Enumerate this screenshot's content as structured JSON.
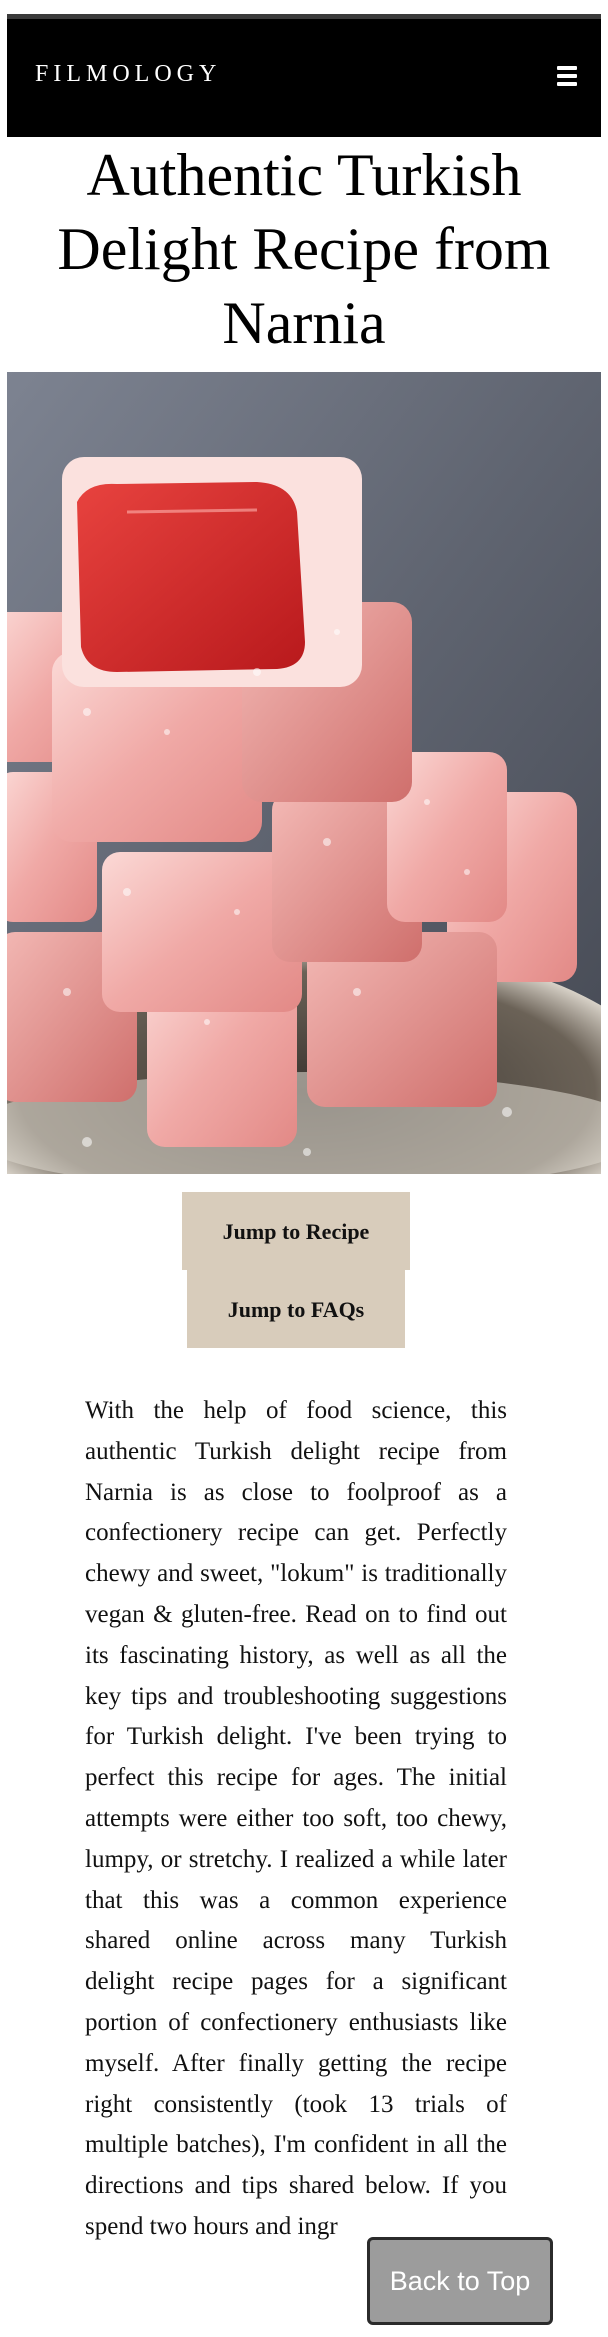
{
  "header": {
    "brand": "FILMOLOGY",
    "menu_icon": "hamburger-menu-icon",
    "background": "#000000"
  },
  "article": {
    "title": "Authentic Turkish Delight Recipe from Narnia",
    "hero_image": "turkish-delight-photo",
    "buttons": {
      "jump_to_recipe": "Jump to Recipe",
      "jump_to_faqs": "Jump to FAQs"
    },
    "button_color": "#d8ccbb",
    "intro": "With the help of food science, this authentic Turkish delight recipe from Narnia is as close to foolproof as a confectionery recipe can get. Perfectly chewy and sweet, \"lokum\" is traditionally vegan & gluten-free. Read on to find out its fascinating history, as well as all the key tips and troubleshooting suggestions for Turkish delight. I've been trying to perfect this recipe for ages. The initial attempts were either too soft, too chewy, lumpy, or stretchy. I realized a while later that this was a common experience shared online across many Turkish delight recipe pages for a significant portion of confectionery enthusiasts like myself. After finally getting the recipe right consistently (took 13 trials of multiple batches), I'm confident in all the directions and tips shared below. If you spend two hours and ingr"
  },
  "floating": {
    "back_to_top": "Back to Top"
  }
}
